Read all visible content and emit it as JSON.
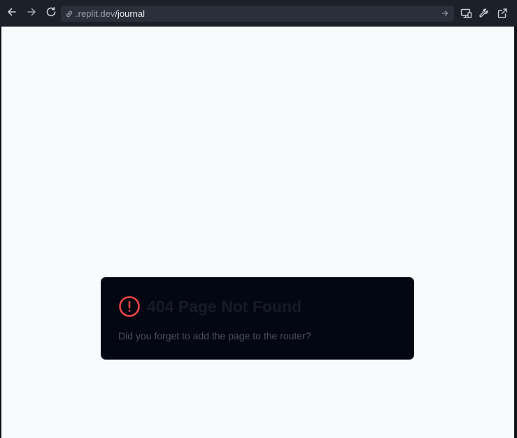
{
  "browser": {
    "url_host": ".replit.dev",
    "url_path": "/journal",
    "icons": {
      "back": "arrow-left-icon",
      "forward": "arrow-right-icon",
      "reload": "reload-icon",
      "link": "link-icon",
      "go": "arrow-right-icon",
      "devices": "monitor-icon",
      "devtools": "wrench-icon",
      "open_external": "external-link-icon"
    }
  },
  "error_card": {
    "title": "404 Page Not Found",
    "message": "Did you forget to add the page to the router?",
    "icon": "alert-circle-icon",
    "icon_color": "#ef4444"
  },
  "colors": {
    "page_background": "#f8fafc",
    "card_background": "#020712",
    "chrome_background": "#1c2029"
  }
}
